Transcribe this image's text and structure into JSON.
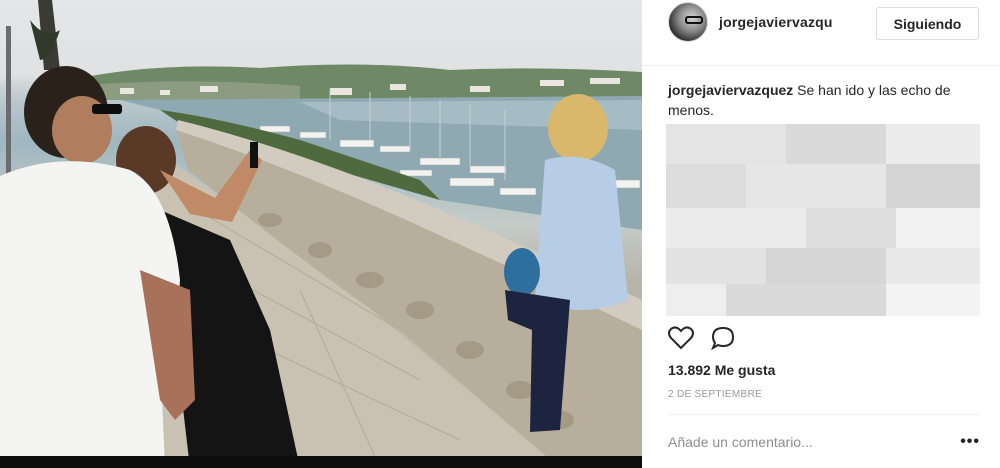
{
  "post": {
    "author": {
      "username": "jorgejaviervazqu"
    },
    "follow_button_label": "Siguiendo",
    "caption": {
      "username": "jorgejaviervazquez",
      "text": " Se han ido y las echo de menos."
    },
    "likes_text": "13.892 Me gusta",
    "date": "2 DE SEPTIEMBRE",
    "comment": {
      "placeholder": "Añade un comentario...",
      "more_label": "•••"
    },
    "icons": {
      "like": "heart-icon",
      "comment": "comment-bubble-icon",
      "more": "more-options-icon"
    }
  },
  "colors": {
    "text": "#262626",
    "muted": "#999999",
    "border": "#dbdbdb",
    "divider": "#efefef"
  }
}
